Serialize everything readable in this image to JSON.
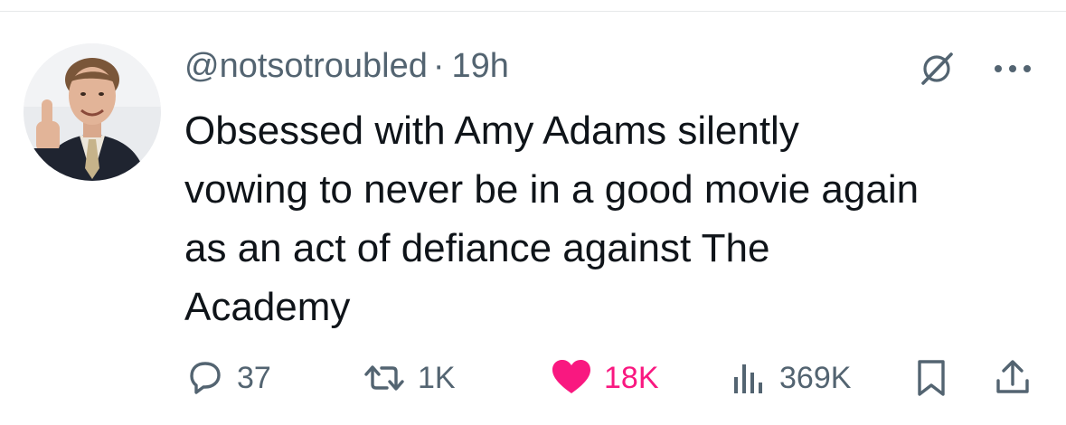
{
  "tweet": {
    "handle": "@notsotroubled",
    "separator": "·",
    "time": "19h",
    "text_lines": [
      "Obsessed with Amy Adams silently",
      "vowing to never be in a good movie again",
      "as an act of defiance against The",
      "Academy"
    ]
  },
  "actions": {
    "replies": "37",
    "reposts": "1K",
    "likes": "18K",
    "views": "369K"
  },
  "icons": {
    "avatar": "profile-photo",
    "grok": "grok-icon",
    "more": "more-icon",
    "reply": "reply-icon",
    "repost": "repost-icon",
    "like": "heart-icon",
    "views": "views-icon",
    "bookmark": "bookmark-icon",
    "share": "share-icon"
  },
  "colors": {
    "text": "#0f1419",
    "secondary": "#536471",
    "like": "#f91880",
    "divider": "#e7e9ea"
  }
}
